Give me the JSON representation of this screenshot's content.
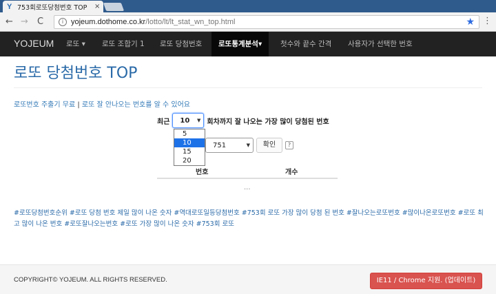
{
  "browser": {
    "tab_favicon": "Y",
    "tab_title": "753회로또당첨번호 TOP",
    "tab_close": "×",
    "back": "←",
    "forward": "→",
    "reload": "C",
    "url_host": "yojeum.dothome.co.kr",
    "url_path": "/lotto/lt/lt_stat_wn_top.html",
    "info_icon": "i",
    "star": "★",
    "menu": "⋮"
  },
  "navbar": {
    "brand": "YOJEUM",
    "items": [
      {
        "label": "로또 ▾"
      },
      {
        "label": "로또 조합기 1"
      },
      {
        "label": "로또 당첨번호"
      },
      {
        "label": "로또통계분석▾"
      },
      {
        "label": "첫수와 끝수 간격"
      },
      {
        "label": "사용자가 선택한 번호"
      }
    ]
  },
  "page": {
    "title": "로또 당첨번호 TOP",
    "link1": "로또번호 주출기 무료",
    "separator": " | ",
    "link2": "로또 잘 안나오는 번호를 알 수 있어요",
    "recent_prefix": "최근",
    "recent_select_value": "10",
    "recent_suffix": "회차까지 잘 나오는 가장 많이 당첨된 번호",
    "recent_options": [
      "5",
      "10",
      "15",
      "20"
    ],
    "round_select_value": "751",
    "confirm_label": "확인",
    "help_label": "?",
    "table_headers": [
      "번호",
      "개수"
    ],
    "ellipsis": "...",
    "tags": "#로또당첨번호순위 #로또 당첨 번호 제일 많이 나온 숫자 #역대로또일등당첨번호 #753회 로또 가장 많이 당첨 된 번호 #잘나오는로또번호 #많이나온로또번호 #로또 최고 많이 나온 번호 #로또잘나오는번호 #로또 가장 많이 나온 숫자 #753회 로또"
  },
  "footer": {
    "copyright": "COPYRIGHT© YOJEUM. ALL RIGHTS RESERVED.",
    "ie_button": "IE11 / Chrome 지원. (업데이트)"
  },
  "colors": {
    "navbar_bg": "#222222",
    "title_blue": "#2a6aa8",
    "link_blue": "#337ab7",
    "dropdown_highlight": "#1e72e8",
    "ie_button_red": "#d9534f"
  }
}
